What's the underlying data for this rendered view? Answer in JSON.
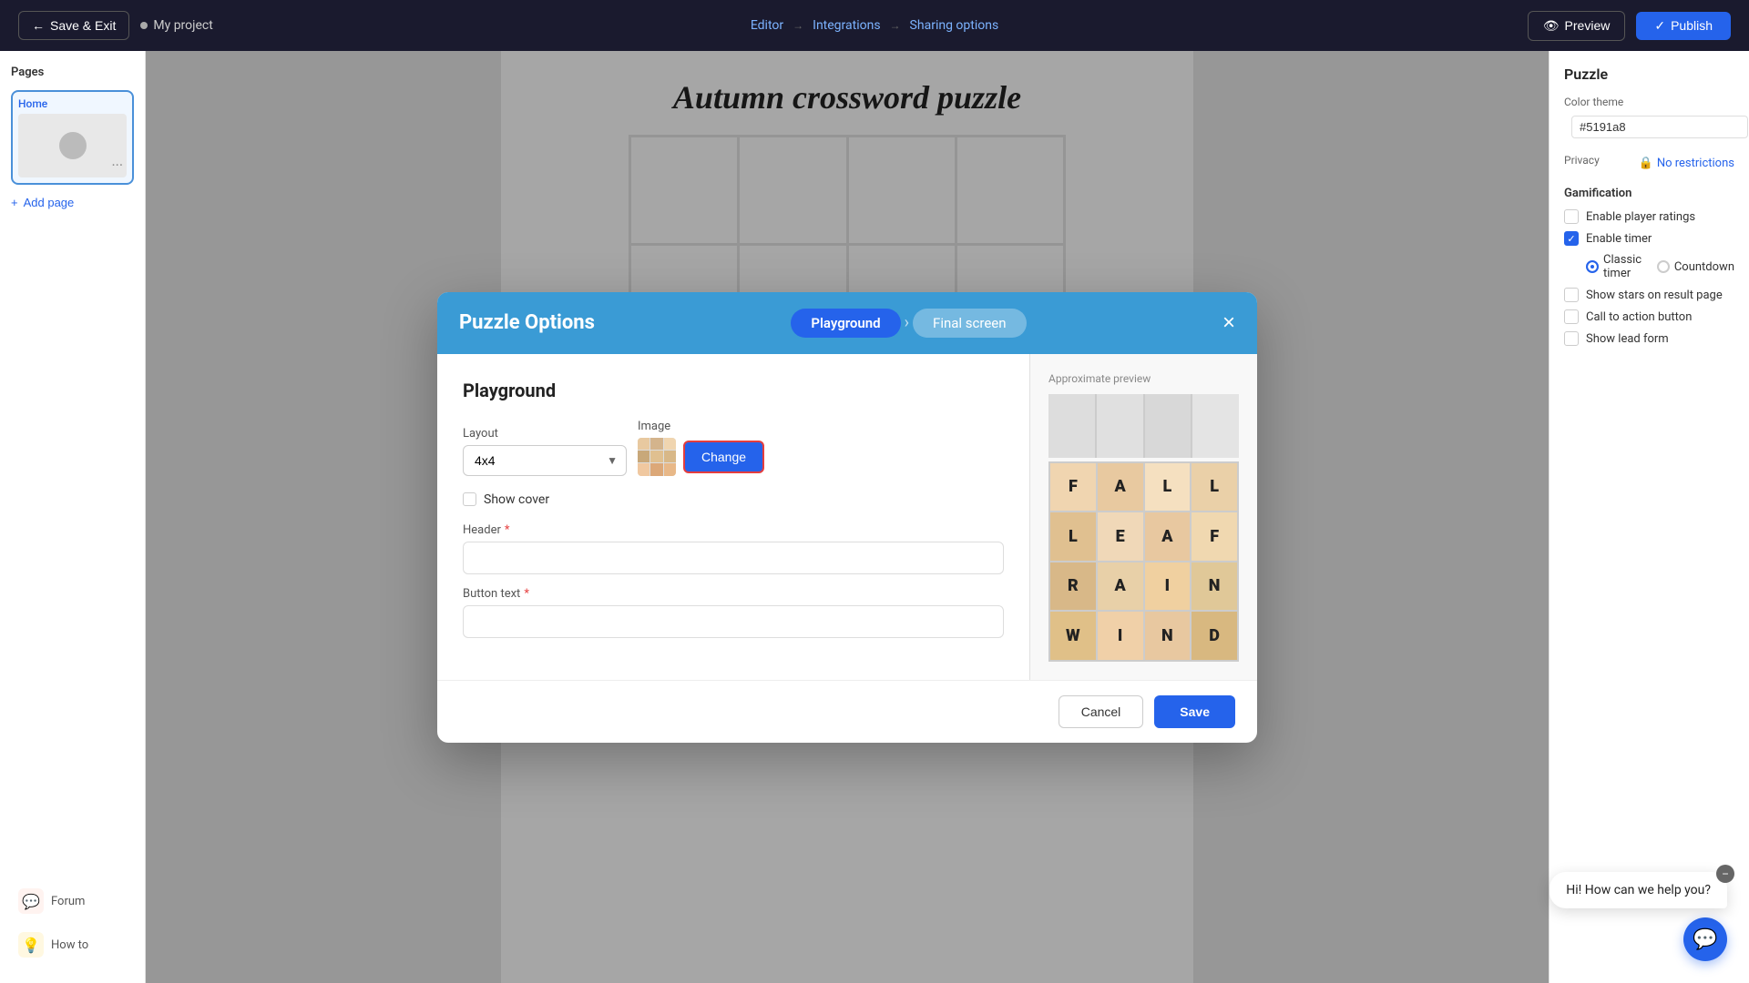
{
  "topNav": {
    "saveExit": "Save & Exit",
    "projectName": "My project",
    "editorStep": "Editor",
    "integrationsStep": "Integrations",
    "sharingStep": "Sharing options",
    "previewBtn": "Preview",
    "publishBtn": "Publish"
  },
  "sidebar": {
    "title": "Pages",
    "pageLabel": "Home",
    "addPage": "Add page"
  },
  "rightPanel": {
    "title": "Puzzle",
    "colorThemeLabel": "Color theme",
    "colorValue": "#5191a8",
    "privacyLabel": "Privacy",
    "privacyValue": "No restrictions",
    "gamificationTitle": "Gamification",
    "enablePlayerRatings": "Enable player ratings",
    "enableTimer": "Enable timer",
    "classicTimer": "Classic timer",
    "countdown": "Countdown",
    "showStars": "Show stars on result page",
    "callToAction": "Call to action button",
    "showLeadForm": "Show lead form"
  },
  "modal": {
    "title": "Puzzle Options",
    "step1": "Playground",
    "step2": "Final screen",
    "closeBtn": "×",
    "sectionTitle": "Playground",
    "layoutLabel": "Layout",
    "layoutValue": "4x4",
    "imageLabel": "Image",
    "changeBtn": "Change",
    "showCoverLabel": "Show cover",
    "headerLabel": "Header",
    "headerRequired": "*",
    "headerPlaceholder": "",
    "buttonTextLabel": "Button text",
    "buttonTextRequired": "*",
    "buttonTextPlaceholder": "",
    "approxPreviewLabel": "Approximate preview",
    "cancelBtn": "Cancel",
    "saveBtn": "Save",
    "previewLetters": [
      "F",
      "A",
      "L",
      "L",
      "L",
      "E",
      "A",
      "F",
      "R",
      "A",
      "I",
      "N",
      "W",
      "I",
      "N",
      "D"
    ]
  },
  "puzzleTitle": "Autumn crossword puzzle",
  "chatWidget": {
    "message": "Hi! How can we help you?"
  },
  "bottomNav": {
    "forumLabel": "Forum",
    "howToLabel": "How to"
  }
}
